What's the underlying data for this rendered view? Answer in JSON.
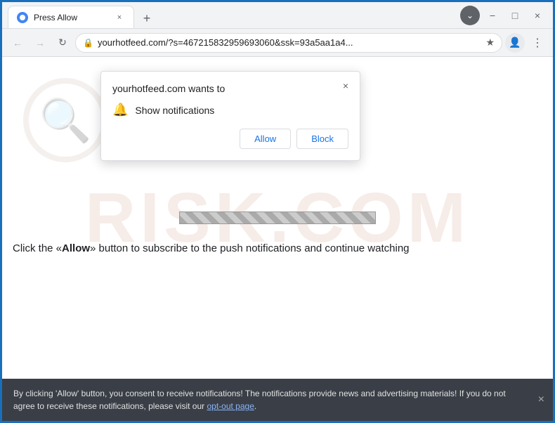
{
  "browser": {
    "tab_title": "Press Allow",
    "tab_close_label": "×",
    "new_tab_label": "+",
    "window_minimize": "−",
    "window_maximize": "□",
    "window_close": "×"
  },
  "addressbar": {
    "url": "yourhotfeed.com/?s=467215832959693060&ssk=93a5aa1a4...",
    "back_title": "Back",
    "forward_title": "Forward",
    "reload_title": "Reload"
  },
  "popup": {
    "title": "yourhotfeed.com wants to",
    "close_label": "×",
    "permission_label": "Show notifications",
    "allow_label": "Allow",
    "block_label": "Block"
  },
  "page": {
    "main_text_prefix": "Click the «",
    "allow_word": "Allow",
    "main_text_suffix": "» button to subscribe to the push notifications and continue watching",
    "watermark_text": "RISK.COM"
  },
  "footer": {
    "text": "By clicking 'Allow' button, you consent to receive notifications! The notifications provide news and advertising materials! If you do not agree to receive these notifications, please visit our ",
    "link_text": "opt-out page",
    "close_label": "×"
  }
}
